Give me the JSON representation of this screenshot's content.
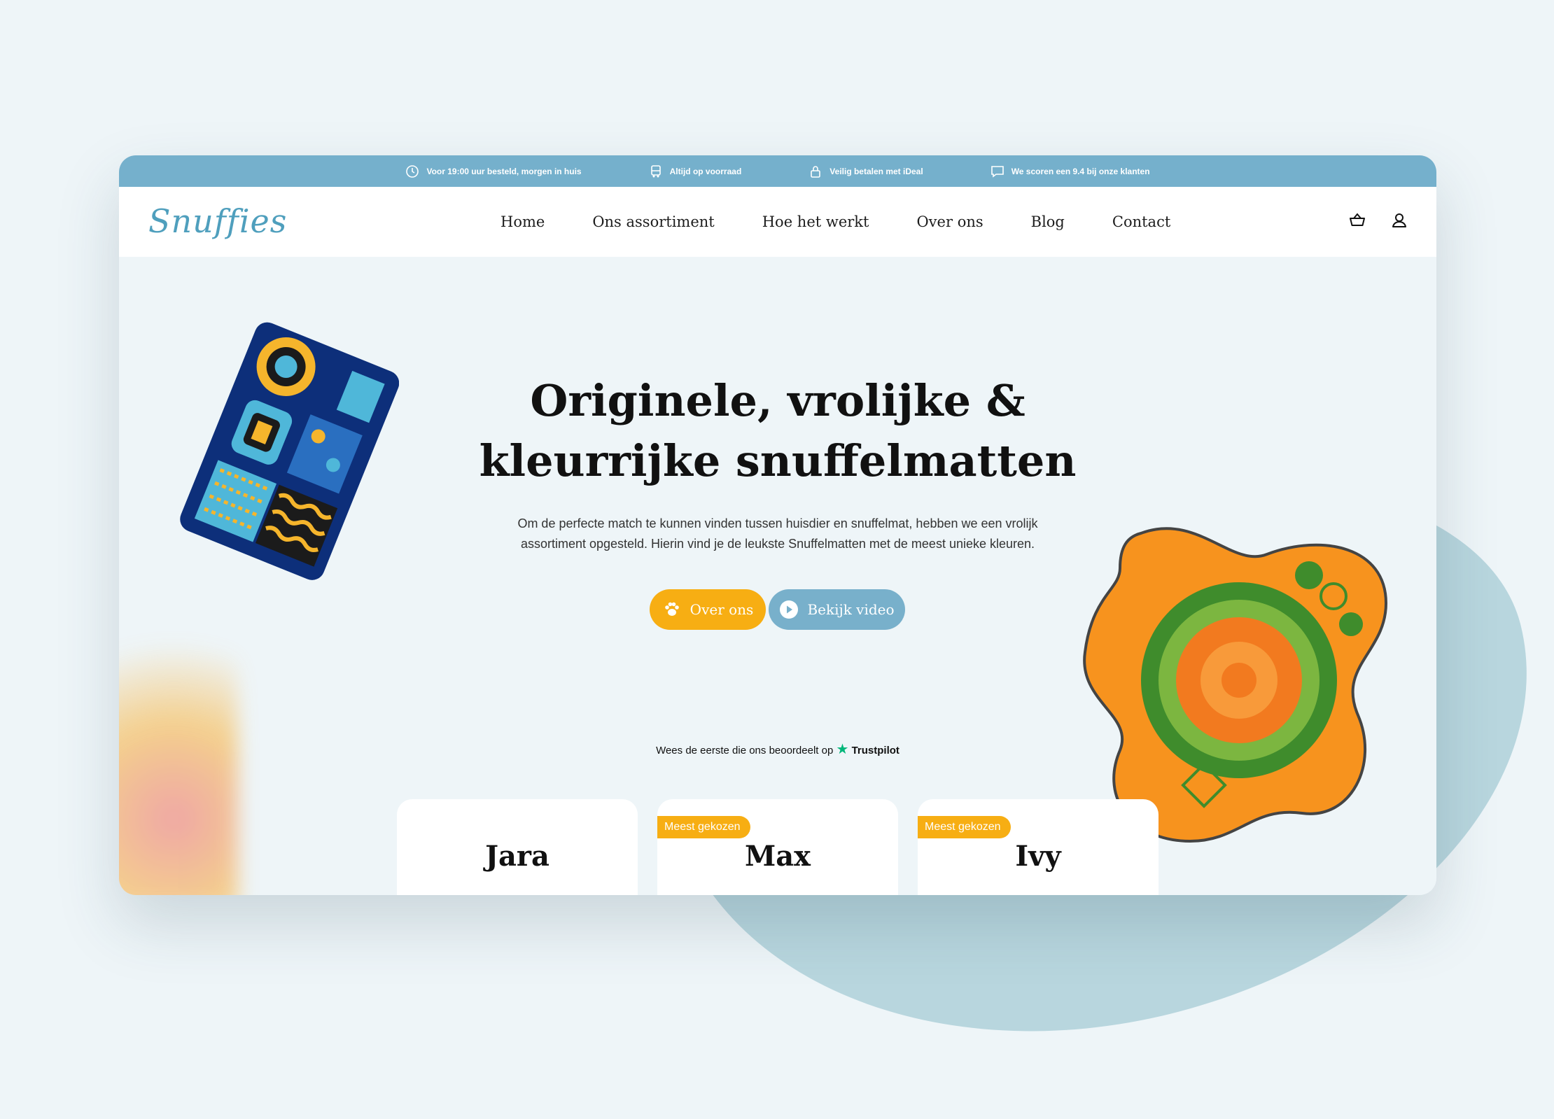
{
  "topbar": {
    "items": [
      {
        "icon": "clock-icon",
        "text": "Voor 19:00 uur besteld, morgen in huis"
      },
      {
        "icon": "truck-icon",
        "text": "Altijd op voorraad"
      },
      {
        "icon": "lock-icon",
        "text": "Veilig betalen met iDeal"
      },
      {
        "icon": "chat-icon",
        "text": "We scoren een 9.4 bij onze klanten"
      }
    ]
  },
  "header": {
    "logo": "Snuffies",
    "nav": [
      "Home",
      "Ons assortiment",
      "Hoe het werkt",
      "Over ons",
      "Blog",
      "Contact"
    ],
    "icons": [
      "basket-icon",
      "user-icon"
    ]
  },
  "hero": {
    "title_line1": "Originele, vrolijke &",
    "title_line2": "kleurrijke snuffelmatten",
    "subtitle": "Om de perfecte match te kunnen vinden tussen huisdier en snuffelmat, hebben we een vrolijk assortiment opgesteld. Hierin vind je de leukste Snuffelmatten met de meest unieke kleuren.",
    "btn_primary": "Over ons",
    "btn_secondary": "Bekijk video"
  },
  "trustpilot": {
    "text": "Wees de eerste die ons beoordeelt op",
    "brand": "Trustpilot"
  },
  "products": [
    {
      "name": "Jara",
      "badge": ""
    },
    {
      "name": "Max",
      "badge": "Meest gekozen"
    },
    {
      "name": "Ivy",
      "badge": "Meest gekozen"
    }
  ],
  "colors": {
    "accent_blue": "#75b0cc",
    "accent_orange": "#f7ae13",
    "background": "#eef5f8"
  }
}
